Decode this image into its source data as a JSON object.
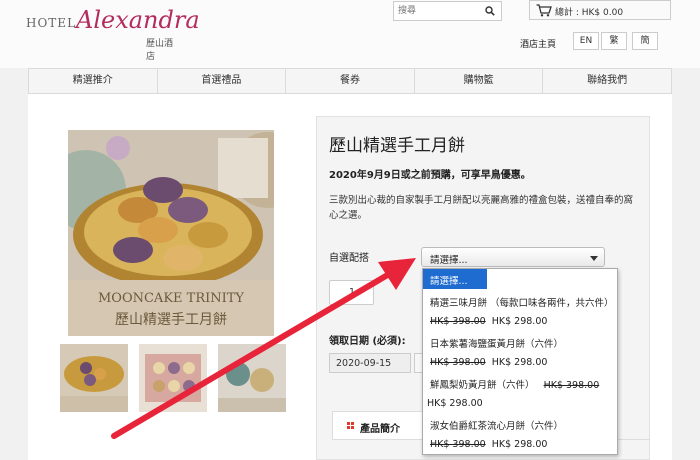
{
  "header": {
    "logo": {
      "hotel": "HOTEL",
      "script": "Alexandra",
      "chinese": "歷山酒店"
    },
    "search": {
      "placeholder": "搜尋",
      "icon": "search-icon"
    },
    "cart": {
      "label": "總計 : HK$ 0.00",
      "icon": "cart-icon"
    },
    "hotel_home": "酒店主頁",
    "languages": [
      "EN",
      "繁",
      "簡"
    ]
  },
  "nav": {
    "items": [
      "精選推介",
      "首選禮品",
      "餐券",
      "購物籃",
      "聯絡我們"
    ]
  },
  "product": {
    "title": "歷山精選手工月餅",
    "offer": "2020年9月9日或之前預購，可享早鳥優惠。",
    "description": "三款別出心裁的自家製手工月餅配以亮麗高雅的禮盒包裝，送禮自奉的窩心之選。",
    "image_caption_en": "MOONCAKE TRINITY",
    "image_caption_zh": "歷山精選手工月餅",
    "option_label": "自選配搭",
    "select_value": "請選擇...",
    "quantity": "1",
    "date_label": "領取日期 (必須):",
    "date_value": "2020-09-15",
    "tab_label": "產品簡介"
  },
  "dropdown": {
    "placeholder": "請選擇...",
    "opt1_name": "精選三味月餅 （每款口味各兩件，共六件）",
    "opt1_old": "HK$ 398.00",
    "opt1_new": "HK$ 298.00",
    "opt2_name": "日本紫薯海鹽蛋黃月餅（六件）",
    "opt2_old": "HK$ 398.00",
    "opt2_new": "HK$ 298.00",
    "opt3_name": "鮮鳳梨奶黃月餅（六件）",
    "opt3_old": "HK$ 398.00",
    "opt3_new": "HK$ 298.00",
    "opt4_name": "淑女伯爵紅茶流心月餅（六件）",
    "opt4_old": "HK$ 398.00",
    "opt4_new": "HK$ 298.00"
  },
  "colors": {
    "brand": "#b32c5e",
    "highlight": "#1e6ccf",
    "arrow": "#e8243a",
    "tab_icon": "#e03a2f"
  }
}
